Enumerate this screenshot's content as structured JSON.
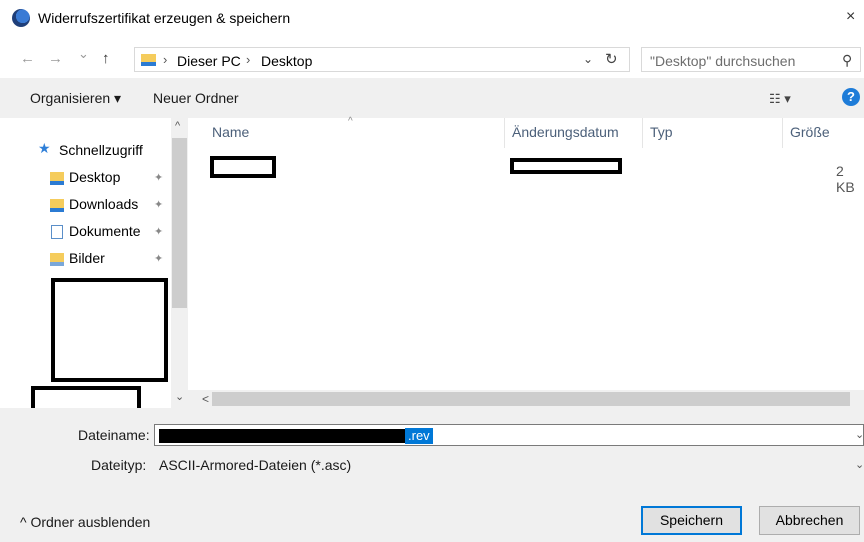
{
  "window": {
    "title": "Widerrufszertifikat erzeugen & speichern",
    "close_glyph": "×",
    "app_icon": "thunderbird-icon"
  },
  "nav": {
    "back_glyph": "←",
    "forward_glyph": "→",
    "history_glyph": "⌄",
    "up_glyph": "↑"
  },
  "address": {
    "crumbs": [
      "Dieser PC",
      "Desktop"
    ],
    "separator": "›",
    "dropdown_glyph": "⌄",
    "refresh_glyph": "↻"
  },
  "search": {
    "placeholder": "\"Desktop\" durchsuchen",
    "icon_glyph": "⚲"
  },
  "toolbar": {
    "organize": "Organisieren ▾",
    "new_folder": "Neuer Ordner",
    "view_glyph": "☷ ▾",
    "help_glyph": "?"
  },
  "sidebar": {
    "quick_access": "Schnellzugriff",
    "items": [
      {
        "label": "Desktop",
        "pin": "✦"
      },
      {
        "label": "Downloads",
        "pin": "✦"
      },
      {
        "label": "Dokumente",
        "pin": "✦"
      },
      {
        "label": "Bilder",
        "pin": "✦"
      }
    ],
    "scroll_up": "^",
    "scroll_down": "⌄"
  },
  "columns": {
    "name": "Name",
    "date": "Änderungsdatum",
    "type": "Typ",
    "size": "Größe",
    "sort_caret": "^"
  },
  "files": [
    {
      "size": "2 KB"
    }
  ],
  "hscroll": {
    "left_arrow": "<"
  },
  "filename": {
    "label": "Dateiname:",
    "selected_suffix": ".rev",
    "dropdown_glyph": "⌄"
  },
  "filetype": {
    "label": "Dateityp:",
    "value": "ASCII-Armored-Dateien (*.asc)",
    "dropdown_glyph": "⌄"
  },
  "footer": {
    "toggle": "^ Ordner ausblenden",
    "save": "Speichern",
    "cancel": "Abbrechen"
  },
  "colors": {
    "accent": "#0078d7",
    "folder": "#f5cc5c",
    "header_text": "#4c607a"
  }
}
